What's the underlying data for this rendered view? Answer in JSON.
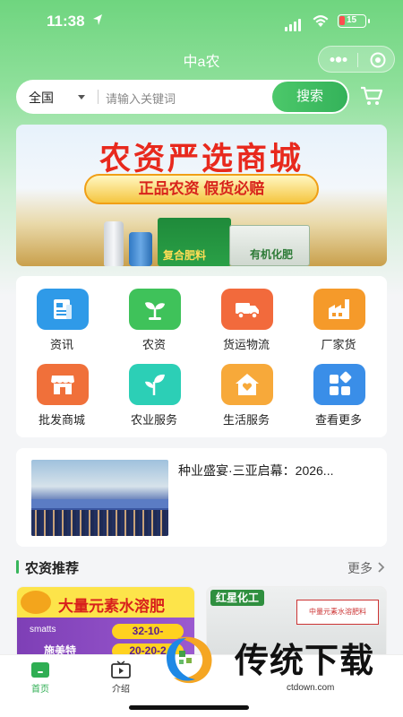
{
  "status_bar": {
    "time": "11:38",
    "battery": "15"
  },
  "nav": {
    "title": "中a农"
  },
  "search": {
    "region": "全国",
    "placeholder": "请输入关键词",
    "button": "搜索"
  },
  "banner": {
    "headline": "农资严选商城",
    "slogan": "正品农资  假货必赔",
    "bag1_label": "复合肥料",
    "bag2_label": "有机化肥"
  },
  "categories": [
    {
      "label": "资讯",
      "icon": "news-icon",
      "color": "#2f9ae8"
    },
    {
      "label": "农资",
      "icon": "sprout-icon",
      "color": "#3fc25a"
    },
    {
      "label": "货运物流",
      "icon": "truck-icon",
      "color": "#f26a3c"
    },
    {
      "label": "厂家货",
      "icon": "factory-icon",
      "color": "#f59a2a"
    },
    {
      "label": "批发商城",
      "icon": "store-icon",
      "color": "#f0703a"
    },
    {
      "label": "农业服务",
      "icon": "seedling-icon",
      "color": "#2ccfb6"
    },
    {
      "label": "生活服务",
      "icon": "house-heart-icon",
      "color": "#f7a93a"
    },
    {
      "label": "查看更多",
      "icon": "grid-more-icon",
      "color": "#3a8ee8"
    }
  ],
  "news": {
    "title": "种业盛宴·三亚启幕：2026..."
  },
  "section": {
    "title": "农资推荐",
    "more": "更多"
  },
  "products": [
    {
      "headline": "大量元素水溶肥",
      "brand": "smatts",
      "name": "施美特",
      "tags": [
        "32-10-",
        "20-20-2"
      ]
    },
    {
      "badge": "红星化工",
      "label": "中量元素水溶肥料"
    }
  ],
  "watermark": {
    "text": "传统下载",
    "url": "ctdown.com"
  },
  "tabbar": [
    {
      "label": "首页",
      "icon": "home-icon",
      "active": true
    },
    {
      "label": "介绍",
      "icon": "video-icon",
      "active": false
    }
  ]
}
